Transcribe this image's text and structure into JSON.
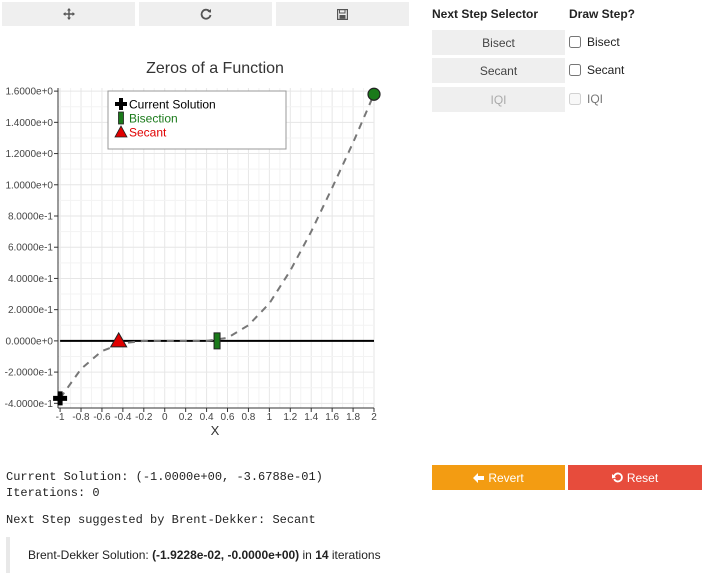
{
  "toolbar": {
    "pan_icon": "move-icon",
    "reset_icon": "refresh-icon",
    "save_icon": "save-icon"
  },
  "selector": {
    "title": "Next Step Selector",
    "buttons": [
      {
        "label": "Bisect",
        "enabled": true
      },
      {
        "label": "Secant",
        "enabled": true
      },
      {
        "label": "IQI",
        "enabled": false
      }
    ]
  },
  "draw_step": {
    "title": "Draw Step?",
    "options": [
      {
        "label": "Bisect",
        "checked": false,
        "enabled": true
      },
      {
        "label": "Secant",
        "checked": false,
        "enabled": true
      },
      {
        "label": "IQI",
        "checked": false,
        "enabled": false
      }
    ]
  },
  "status": {
    "current_solution": "Current Solution: (-1.0000e+00, -3.6788e-01)",
    "iterations": "Iterations: 0",
    "next_step": "Next Step suggested by Brent-Dekker: Secant"
  },
  "actions": {
    "revert_label": "Revert",
    "reset_label": "Reset",
    "revert_color": "#f39c12",
    "reset_color": "#e74c3c"
  },
  "result": {
    "prefix": "Brent-Dekker Solution: ",
    "value": "(-1.9228e-02, -0.0000e+00)",
    "middle": " in ",
    "iterations": "14",
    "suffix": " iterations"
  },
  "chart_data": {
    "type": "line",
    "title": "Zeros of a Function",
    "xlabel": "X",
    "ylabel": "",
    "xlim": [
      -1.02,
      2.0
    ],
    "ylim": [
      -0.43,
      1.62
    ],
    "x_ticks": [
      -1,
      -0.8,
      -0.6,
      -0.4,
      -0.2,
      0,
      0.2,
      0.4,
      0.6,
      0.8,
      1,
      1.2,
      1.4,
      1.6,
      1.8,
      2
    ],
    "x_tick_labels": [
      "-1",
      "-0.8",
      "-0.6",
      "-0.4",
      "-0.2",
      "0",
      "0.2",
      "0.4",
      "0.6",
      "0.8",
      "1",
      "1.2",
      "1.4",
      "1.6",
      "1.8",
      "2"
    ],
    "y_ticks": [
      -0.4,
      -0.2,
      0,
      0.2,
      0.4,
      0.6,
      0.8,
      1.0,
      1.2,
      1.4,
      1.6
    ],
    "y_tick_labels": [
      "-4.0000e-1",
      "-2.0000e-1",
      "0.0000e+0",
      "2.0000e-1",
      "4.0000e-1",
      "6.0000e-1",
      "8.0000e-1",
      "1.0000e+0",
      "1.2000e+0",
      "1.4000e+0",
      "1.6000e+0"
    ],
    "grid": true,
    "legend_position": "top-left",
    "legend": [
      {
        "name": "Current Solution",
        "color": "#000000",
        "marker": "cross"
      },
      {
        "name": "Bisection",
        "color": "#1a7a1a",
        "marker": "bar"
      },
      {
        "name": "Secant",
        "color": "#e00000",
        "marker": "triangle"
      }
    ],
    "curve": {
      "x": [
        -1.0,
        -0.8,
        -0.6,
        -0.4,
        -0.2,
        0.0,
        0.2,
        0.4,
        0.6,
        0.8,
        1.0,
        1.2,
        1.4,
        1.6,
        1.8,
        2.0
      ],
      "y": [
        -0.368,
        -0.18,
        -0.065,
        -0.015,
        0.0,
        0.0,
        0.0,
        0.0,
        0.02,
        0.1,
        0.24,
        0.45,
        0.7,
        0.98,
        1.27,
        1.58
      ],
      "color": "#777777",
      "style": "dashed"
    },
    "zero_line": {
      "x": [
        -1.0,
        2.0
      ],
      "y": [
        0,
        0
      ],
      "color": "#000000"
    },
    "markers": {
      "current_solution": {
        "x": -1.0,
        "y": -0.368,
        "color": "#000000"
      },
      "bisection": {
        "x": 0.5,
        "y": 0.0,
        "color": "#1a7a1a"
      },
      "secant": {
        "x": -0.44,
        "y": 0.0,
        "color": "#e00000"
      },
      "endpoint": {
        "x": 2.0,
        "y": 1.58,
        "color": "#1a7a1a"
      }
    }
  }
}
